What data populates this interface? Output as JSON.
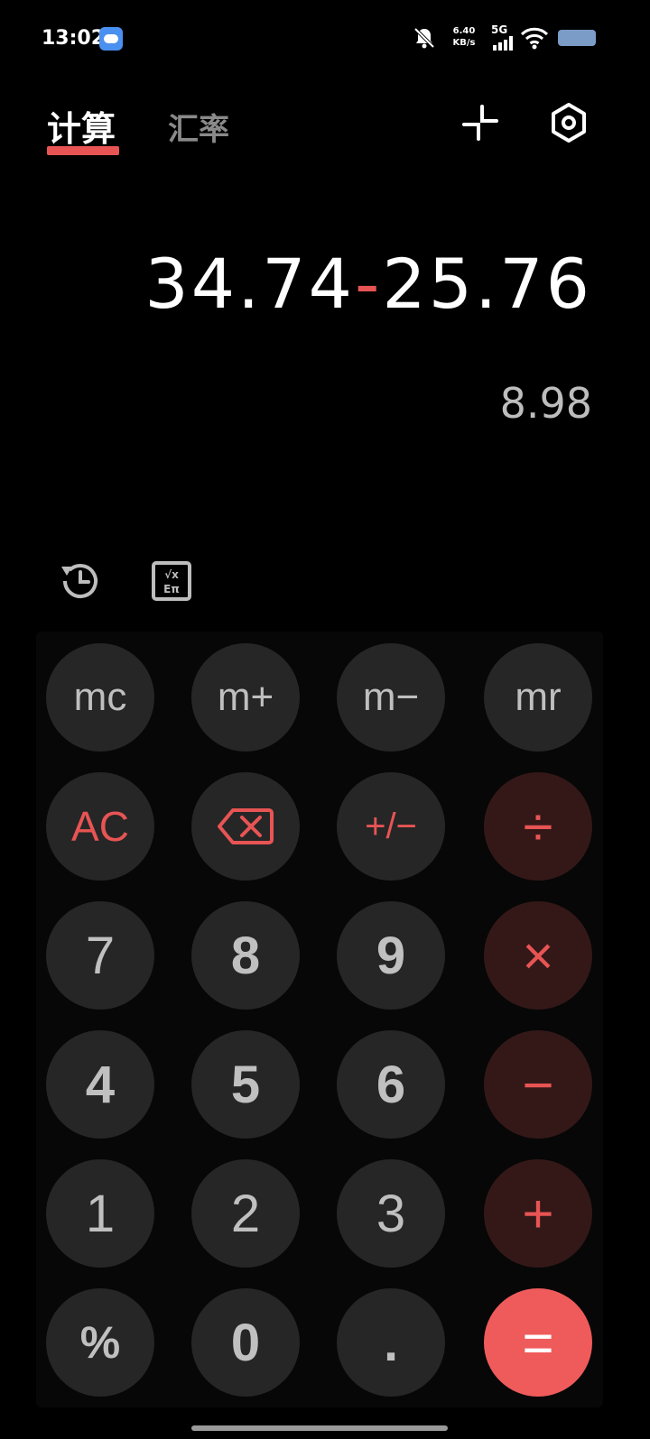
{
  "status_bar": {
    "time": "13:02",
    "net_speed_value": "6.40",
    "net_speed_unit": "KB/s",
    "network_type": "5G"
  },
  "tabs": [
    {
      "label": "计算",
      "active": true
    },
    {
      "label": "汇率",
      "active": false
    }
  ],
  "display": {
    "operand1": "34.74",
    "operator": "-",
    "operand2": "25.76",
    "result": "8.98"
  },
  "keys": {
    "mc": "mc",
    "m_plus": "m+",
    "m_minus": "m−",
    "mr": "mr",
    "ac": "AC",
    "backspace_icon": "backspace-icon",
    "plus_minus": "+/−",
    "divide": "÷",
    "seven": "7",
    "eight": "8",
    "nine": "9",
    "multiply": "×",
    "four": "4",
    "five": "5",
    "six": "6",
    "minus": "−",
    "one": "1",
    "two": "2",
    "three": "3",
    "plus": "+",
    "percent": "%",
    "zero": "0",
    "decimal": ".",
    "equals": "="
  },
  "colors": {
    "accent": "#e85454",
    "key_bg": "#262626",
    "operator_bg": "#341818",
    "equals_bg": "#ef5b5b",
    "background": "#000000"
  }
}
